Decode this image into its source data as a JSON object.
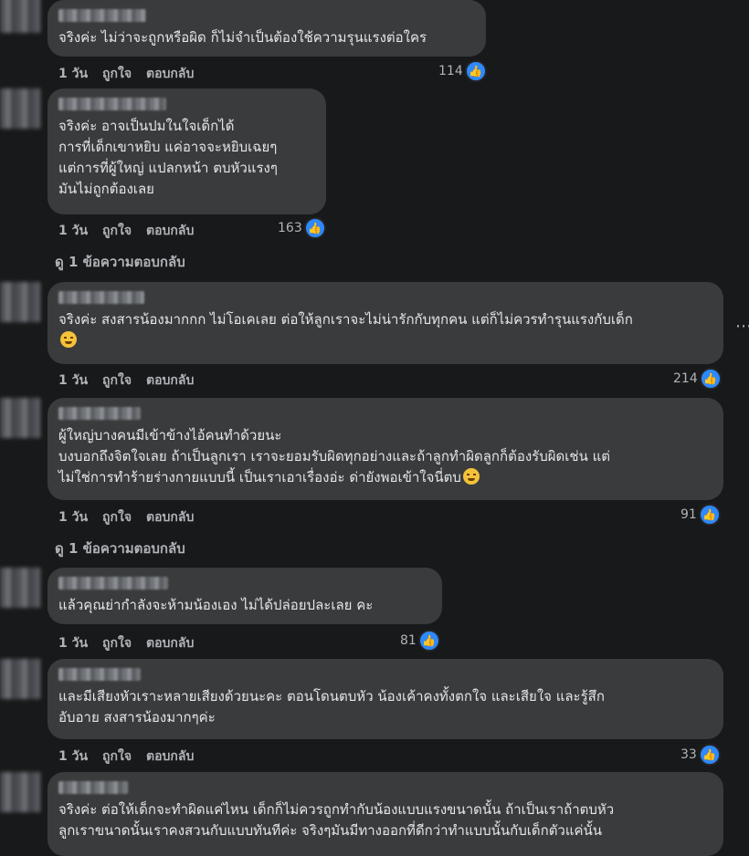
{
  "comments": [
    {
      "text": "จริงค่ะ ไม่ว่าจะถูกหรือผิด ก็ไม่จำเป็นต้องใช้ความรุนแรงต่อใคร",
      "time": "1 วัน",
      "like_label": "ถูกใจ",
      "reply_label": "ตอบกลับ",
      "reactions": "114"
    },
    {
      "text": "จริงค่ะ อาจเป็นปมในใจเด็กได้\nการที่เด็กเขาหยิบ แค่อาจจะหยิบเฉยๆ\nแต่การที่ผู้ใหญ่ แปลกหน้า ตบหัวแรงๆ\nมันไม่ถูกต้องเลย",
      "time": "1 วัน",
      "like_label": "ถูกใจ",
      "reply_label": "ตอบกลับ",
      "reactions": "163",
      "view_replies": "ดู 1 ข้อความตอบกลับ"
    },
    {
      "text": "จริงค่ะ สงสารน้องมากกก ไม่โอเคเลย ต่อให้ลูกเราจะไม่น่ารักกับทุกคน แต่ก็ไม่ควรทำรุนแรงกับเด็ก",
      "time": "1 วัน",
      "like_label": "ถูกใจ",
      "reply_label": "ตอบกลับ",
      "reactions": "214",
      "emoji": "grinning-squinting-face"
    },
    {
      "text": "ผู้ใหญ่บางคนมีเข้าข้างไอ้คนทำด้วยนะ\nบงบอกถึงจิตใจเลย ถ้าเป็นลูกเรา เราจะยอมรับผิดทุกอย่างและถ้าลูกทำผิดลูกก็ต้องรับผิดเช่น แต่\nไม่ใช่การทำร้ายร่างกายแบบนี้ เป็นเราเอาเรื่องอ่ะ ด่ายังพอเข้าใจนี่ตบ",
      "time": "1 วัน",
      "like_label": "ถูกใจ",
      "reply_label": "ตอบกลับ",
      "reactions": "91",
      "emoji": "disappointed-face",
      "view_replies": "ดู 1 ข้อความตอบกลับ"
    },
    {
      "text": "แล้วคุณย่ากำลังจะห้ามน้องเอง ไม่ได้ปล่อยปละเลย คะ",
      "time": "1 วัน",
      "like_label": "ถูกใจ",
      "reply_label": "ตอบกลับ",
      "reactions": "81"
    },
    {
      "text": "และมีเสียงหัวเราะหลายเสียงด้วยนะคะ ตอนโดนตบหัว น้องเค้าคงทั้งตกใจ และเสียใจ และรู้สึก\nอับอาย สงสารน้องมากๆค่ะ",
      "time": "1 วัน",
      "like_label": "ถูกใจ",
      "reply_label": "ตอบกลับ",
      "reactions": "33"
    },
    {
      "text": "จริงค่ะ ต่อให้เด็กจะทำผิดแค่ไหน เด็กก็ไม่ควรถูกทำกับน้องแบบแรงขนาดนั้น ถ้าเป็นเราถ้าตบหัว\nลูกเราขนาดนั้นเราคงสวนกับแบบทันทีค่ะ จริงๆมันมีทางออกที่ดีกว่าทำแบบนั้นกับเด็กตัวแค่นั้น"
    }
  ],
  "more_icon": "ellipsis-icon",
  "colors": {
    "background": "#18191a",
    "bubble": "#3a3b3c",
    "like": "#2e89ff"
  }
}
